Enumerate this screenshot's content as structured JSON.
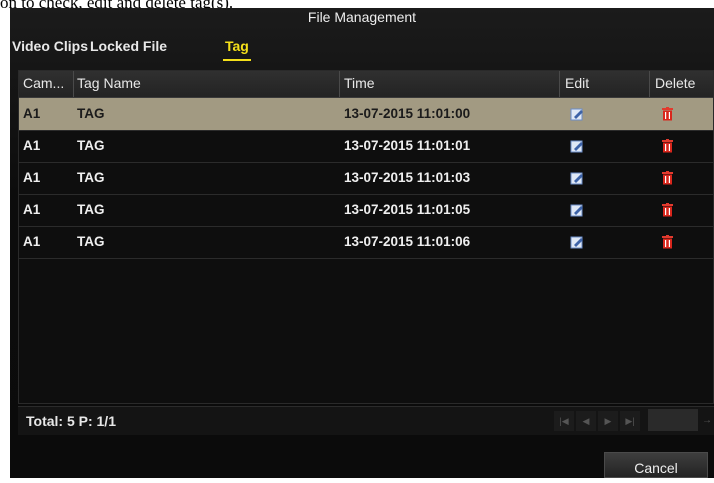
{
  "page_caption": "on to check, edit and delete tag(s).",
  "window": {
    "title": "File Management"
  },
  "tabs": [
    {
      "label": "Video Clips",
      "active": false
    },
    {
      "label": "Locked File",
      "active": false
    },
    {
      "label": "Tag",
      "active": true
    }
  ],
  "table": {
    "columns": [
      "Cam...",
      "Tag Name",
      "Time",
      "Edit",
      "Delete"
    ],
    "rows": [
      {
        "camera": "A1",
        "tag_name": "TAG",
        "time": "13-07-2015 11:01:00",
        "selected": true
      },
      {
        "camera": "A1",
        "tag_name": "TAG",
        "time": "13-07-2015 11:01:01",
        "selected": false
      },
      {
        "camera": "A1",
        "tag_name": "TAG",
        "time": "13-07-2015 11:01:03",
        "selected": false
      },
      {
        "camera": "A1",
        "tag_name": "TAG",
        "time": "13-07-2015 11:01:05",
        "selected": false
      },
      {
        "camera": "A1",
        "tag_name": "TAG",
        "time": "13-07-2015 11:01:06",
        "selected": false
      }
    ],
    "edit_icon": "edit-icon",
    "delete_icon": "trash-icon"
  },
  "footer": {
    "total_text": "Total: 5 P: 1/1",
    "nav_icons": [
      "first-page-icon",
      "prev-page-icon",
      "next-page-icon",
      "last-page-icon",
      "go-arrow-icon"
    ]
  },
  "buttons": {
    "cancel_label": "Cancel"
  },
  "colors": {
    "active_tab": "#f5e01a",
    "selected_row": "#a29a82",
    "delete_icon": "#d9261c",
    "edit_icon": "#6a8cc8"
  }
}
